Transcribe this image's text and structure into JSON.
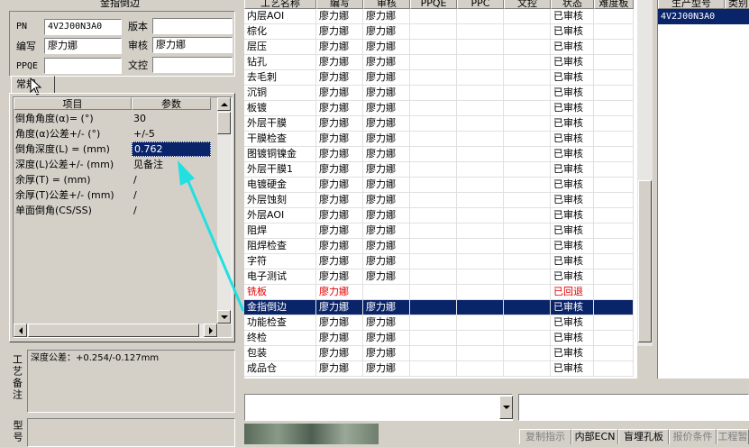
{
  "left": {
    "title": "金指倒边",
    "pn_label": "PN",
    "pn_value": "4V2J00N3A0",
    "version_label": "版本",
    "version_value": "",
    "author_label": "编写",
    "author_value": "廖力娜",
    "review_label": "审核",
    "review_value": "廖力娜",
    "ppqe_label": "PPQE",
    "ppqe_value": "",
    "doc_label": "文控",
    "doc_value": "",
    "tab_label": "常规",
    "param_table": {
      "headers": [
        "项目",
        "参数"
      ],
      "rows": [
        {
          "item": "倒角角度(α)=  (°)",
          "value": "30"
        },
        {
          "item": "角度(α)公差+/-  (°)",
          "value": "+/-5"
        },
        {
          "item": "倒角深度(L) =  (mm)",
          "value": "0.762"
        },
        {
          "item": "深度(L)公差+/-  (mm)",
          "value": "见备注"
        },
        {
          "item": "余厚(T) =  (mm)",
          "value": "/"
        },
        {
          "item": "余厚(T)公差+/-  (mm)",
          "value": "/"
        },
        {
          "item": "单面倒角(CS/SS)",
          "value": "/"
        }
      ],
      "selected_row": 2
    },
    "process_note_label": "工艺备注",
    "process_note_value": "深度公差：+0.254/-0.127mm",
    "model_note_label": "型号"
  },
  "main_table": {
    "headers": [
      "工艺名称",
      "编写",
      "审核",
      "PPQE",
      "PPC",
      "文控",
      "状态",
      "难度板"
    ],
    "rows": [
      {
        "name": "内层AOI",
        "author": "廖力娜",
        "reviewer": "廖力娜",
        "ppqe": "",
        "ppc": "",
        "doc": "",
        "status": "已审核",
        "difficulty": ""
      },
      {
        "name": "棕化",
        "author": "廖力娜",
        "reviewer": "廖力娜",
        "ppqe": "",
        "ppc": "",
        "doc": "",
        "status": "已审核",
        "difficulty": ""
      },
      {
        "name": "层压",
        "author": "廖力娜",
        "reviewer": "廖力娜",
        "ppqe": "",
        "ppc": "",
        "doc": "",
        "status": "已审核",
        "difficulty": ""
      },
      {
        "name": "钻孔",
        "author": "廖力娜",
        "reviewer": "廖力娜",
        "ppqe": "",
        "ppc": "",
        "doc": "",
        "status": "已审核",
        "difficulty": ""
      },
      {
        "name": "去毛刺",
        "author": "廖力娜",
        "reviewer": "廖力娜",
        "ppqe": "",
        "ppc": "",
        "doc": "",
        "status": "已审核",
        "difficulty": ""
      },
      {
        "name": "沉铜",
        "author": "廖力娜",
        "reviewer": "廖力娜",
        "ppqe": "",
        "ppc": "",
        "doc": "",
        "status": "已审核",
        "difficulty": ""
      },
      {
        "name": "板镀",
        "author": "廖力娜",
        "reviewer": "廖力娜",
        "ppqe": "",
        "ppc": "",
        "doc": "",
        "status": "已审核",
        "difficulty": ""
      },
      {
        "name": "外层干膜",
        "author": "廖力娜",
        "reviewer": "廖力娜",
        "ppqe": "",
        "ppc": "",
        "doc": "",
        "status": "已审核",
        "difficulty": ""
      },
      {
        "name": "干膜检查",
        "author": "廖力娜",
        "reviewer": "廖力娜",
        "ppqe": "",
        "ppc": "",
        "doc": "",
        "status": "已审核",
        "difficulty": ""
      },
      {
        "name": "图镀铜镍金",
        "author": "廖力娜",
        "reviewer": "廖力娜",
        "ppqe": "",
        "ppc": "",
        "doc": "",
        "status": "已审核",
        "difficulty": ""
      },
      {
        "name": "外层干膜1",
        "author": "廖力娜",
        "reviewer": "廖力娜",
        "ppqe": "",
        "ppc": "",
        "doc": "",
        "status": "已审核",
        "difficulty": ""
      },
      {
        "name": "电镀硬金",
        "author": "廖力娜",
        "reviewer": "廖力娜",
        "ppqe": "",
        "ppc": "",
        "doc": "",
        "status": "已审核",
        "difficulty": ""
      },
      {
        "name": "外层蚀刻",
        "author": "廖力娜",
        "reviewer": "廖力娜",
        "ppqe": "",
        "ppc": "",
        "doc": "",
        "status": "已审核",
        "difficulty": ""
      },
      {
        "name": "外层AOI",
        "author": "廖力娜",
        "reviewer": "廖力娜",
        "ppqe": "",
        "ppc": "",
        "doc": "",
        "status": "已审核",
        "difficulty": ""
      },
      {
        "name": "阻焊",
        "author": "廖力娜",
        "reviewer": "廖力娜",
        "ppqe": "",
        "ppc": "",
        "doc": "",
        "status": "已审核",
        "difficulty": ""
      },
      {
        "name": "阻焊检查",
        "author": "廖力娜",
        "reviewer": "廖力娜",
        "ppqe": "",
        "ppc": "",
        "doc": "",
        "status": "已审核",
        "difficulty": ""
      },
      {
        "name": "字符",
        "author": "廖力娜",
        "reviewer": "廖力娜",
        "ppqe": "",
        "ppc": "",
        "doc": "",
        "status": "已审核",
        "difficulty": ""
      },
      {
        "name": "电子测试",
        "author": "廖力娜",
        "reviewer": "廖力娜",
        "ppqe": "",
        "ppc": "",
        "doc": "",
        "status": "已审核",
        "difficulty": ""
      },
      {
        "name": "铣板",
        "author": "廖力娜",
        "reviewer": "",
        "ppqe": "",
        "ppc": "",
        "doc": "",
        "status": "已回退",
        "difficulty": ""
      },
      {
        "name": "金指倒边",
        "author": "廖力娜",
        "reviewer": "廖力娜",
        "ppqe": "",
        "ppc": "",
        "doc": "",
        "status": "已审核",
        "difficulty": ""
      },
      {
        "name": "功能检查",
        "author": "廖力娜",
        "reviewer": "廖力娜",
        "ppqe": "",
        "ppc": "",
        "doc": "",
        "status": "已审核",
        "difficulty": ""
      },
      {
        "name": "终检",
        "author": "廖力娜",
        "reviewer": "廖力娜",
        "ppqe": "",
        "ppc": "",
        "doc": "",
        "status": "已审核",
        "difficulty": ""
      },
      {
        "name": "包装",
        "author": "廖力娜",
        "reviewer": "廖力娜",
        "ppqe": "",
        "ppc": "",
        "doc": "",
        "status": "已审核",
        "difficulty": ""
      },
      {
        "name": "成品仓",
        "author": "廖力娜",
        "reviewer": "廖力娜",
        "ppqe": "",
        "ppc": "",
        "doc": "",
        "status": "已审核",
        "difficulty": ""
      }
    ],
    "selected_row": 19,
    "returned_row": 18
  },
  "right_table": {
    "headers": [
      "生产型号",
      "类别"
    ],
    "rows": [
      {
        "model": "4V2J00N3A0",
        "type": ""
      }
    ]
  },
  "bottom_tabs": [
    "复制指示",
    "内部ECN",
    "盲埋孔板",
    "报价条件",
    "工程暂"
  ],
  "colors": {
    "selection": "#0a246a",
    "returned": "#e00000",
    "annotation_arrow": "#22e0e0",
    "window_bg": "#d4d0c8"
  },
  "icons": {
    "cursor": "mouse-pointer-icon",
    "arrow": "cyan-annotation-arrow"
  }
}
